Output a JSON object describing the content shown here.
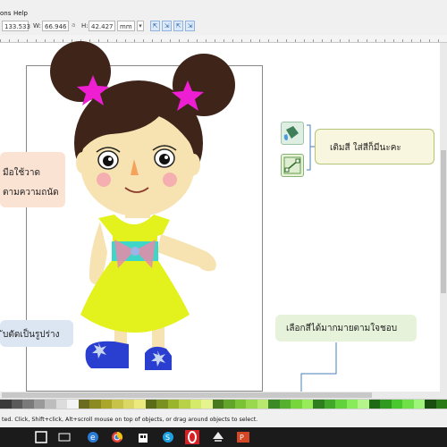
{
  "menubar": {
    "items": [
      "ons",
      "Help"
    ]
  },
  "toolbar": {
    "x_value": "133.533",
    "w_label": "W:",
    "w_value": "66.946",
    "h_label": "H:",
    "h_value": "42.427",
    "unit": "mm",
    "transform_buttons": [
      "⇱",
      "⇲",
      "⇱",
      "⇲"
    ]
  },
  "canvas": {
    "left_note": {
      "line1": "มือใช้วาด",
      "line2": "ตามความถนัด"
    },
    "left_note2": "ับตัดเป็นรูปร่าง",
    "fill_note": "เติมสี ใส่สีก็มีนะคะ",
    "color_note": "เลือกสีได้มากมายตามใจชอบ"
  },
  "icons": {
    "bucket": "paint-bucket-icon",
    "gradient": "gradient-tool-icon"
  },
  "palette": [
    "#3a3a3a",
    "#5a5a5a",
    "#7a7a7a",
    "#9a9a9a",
    "#bdbdbd",
    "#dcdcdc",
    "#f4f4f4",
    "#6b6b1f",
    "#8c8a22",
    "#a9a62b",
    "#c6c24a",
    "#dbd764",
    "#ece97e",
    "#5a6b1a",
    "#7a9021",
    "#99b52b",
    "#b9d148",
    "#d6ea6a",
    "#e6f48f",
    "#4a7a1e",
    "#62a42a",
    "#7cc236",
    "#9ad84f",
    "#b8e86e",
    "#3c8a26",
    "#55b02f",
    "#76d63c",
    "#98ec59",
    "#2f7f1f",
    "#43a82a",
    "#62d23a",
    "#88ec5a",
    "#b5f48b",
    "#1f6a14",
    "#2f9a1f",
    "#48c82c",
    "#6fe048",
    "#9ff47a",
    "#1a4d10",
    "#2a7a18"
  ],
  "statusbar": "ted. Click, Shift+click, Alt+scroll mouse on top of objects, or drag around objects to select.",
  "taskbar": [
    "start-icon",
    "search-icon",
    "task-view-icon",
    "file-explorer-icon",
    "edge-icon",
    "chrome-icon",
    "store-icon",
    "skype-icon",
    "opera-icon",
    "inkscape-icon",
    "powerpoint-icon"
  ]
}
